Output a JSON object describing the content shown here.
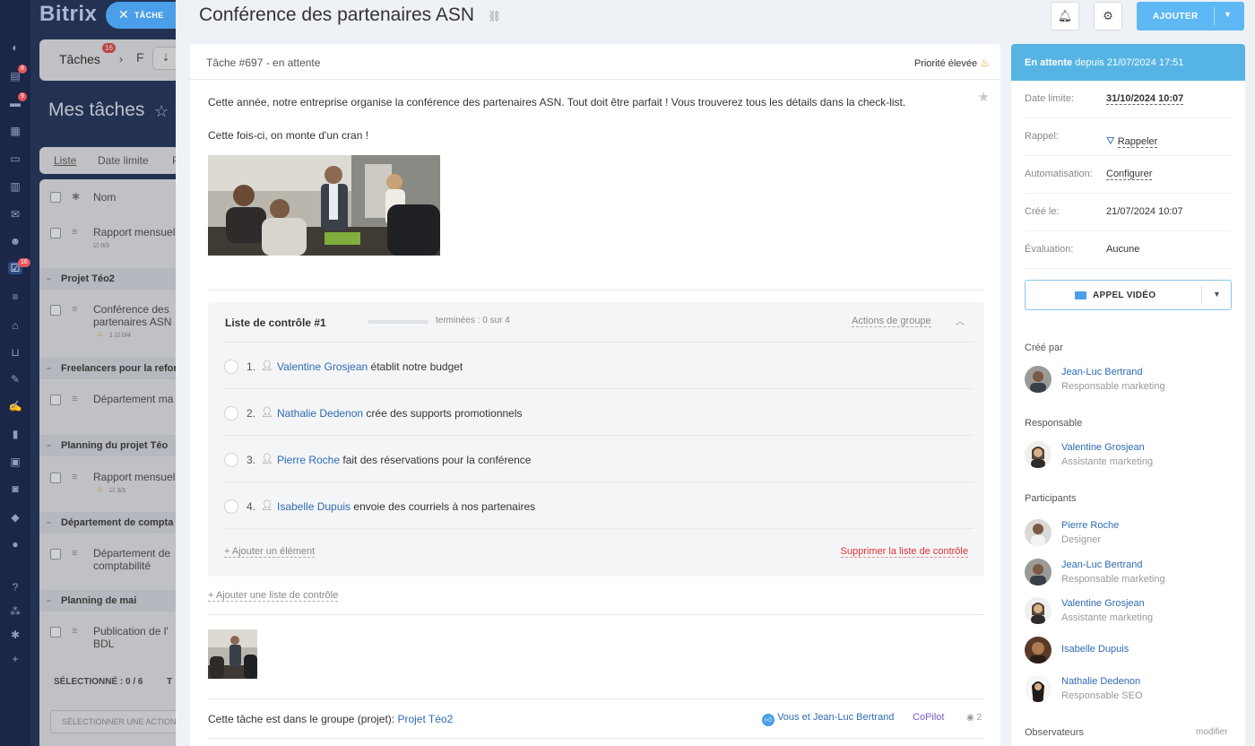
{
  "brand": "Bitrix",
  "close_pill": {
    "label": "TÂCHE"
  },
  "rail": {
    "badges": [
      "8",
      "9",
      "16"
    ]
  },
  "list_bg": {
    "tab_label": "Tâches",
    "tab_badge": "16",
    "tab_sep": "F",
    "heading": "Mes tâches",
    "view_tabs": [
      "Liste",
      "Date limite",
      "P"
    ],
    "column_name": "Nom",
    "rows": [
      {
        "type": "task",
        "text": "Rapport mensuel",
        "meta": "☑ 0/3"
      },
      {
        "type": "group",
        "text": "Projet Téo2"
      },
      {
        "type": "task",
        "text": "Conférence des",
        "text2": "partenaires ASN",
        "meta": "1    ☑ 0/4"
      },
      {
        "type": "group",
        "text": "Freelancers pour la refonte"
      },
      {
        "type": "task",
        "text": "Département ma"
      },
      {
        "type": "group",
        "text": "Planning du projet Téo"
      },
      {
        "type": "task",
        "text": "Rapport mensuel",
        "meta": "☑ 3/3"
      },
      {
        "type": "group",
        "text": "Département de compta"
      },
      {
        "type": "task",
        "text": "Département de",
        "text2": "comptabilité"
      },
      {
        "type": "group",
        "text": "Planning de mai"
      },
      {
        "type": "task",
        "text": "Publication de l'",
        "text2": "BDL"
      }
    ],
    "selected": "SÉLECTIONNÉ : 0 / 6",
    "selected_t": "T",
    "select_action": "SÉLECTIONNER UNE ACTION"
  },
  "header": {
    "title": "Conférence des partenaires ASN",
    "add_label": "AJOUTER"
  },
  "task": {
    "number_status": "Tâche #697 - en attente",
    "priority": "Priorité élevée",
    "description_1": "Cette année, notre entreprise organise la conférence des partenaires ASN. Tout doit être parfait ! Vous trouverez tous les détails dans la check-list.",
    "description_2": "Cette fois-ci, on monte d'un cran !",
    "add_checklist": "+ Ajouter une liste de contrôle",
    "group_prefix": "Cette tâche est dans le groupe (projet): ",
    "group_name": "Projet Téo2",
    "thanks": "Vous et Jean-Luc Bertrand",
    "copilot": "CoPilot",
    "views": "2"
  },
  "checklist": {
    "title": "Liste de contrôle #1",
    "progress_text": "terminées : 0 sur 4",
    "progress_fraction": 0,
    "group_actions": "Actions de groupe",
    "items": [
      {
        "num": "1.",
        "who": "Valentine Grosjean",
        "what": " établit notre budget"
      },
      {
        "num": "2.",
        "who": "Nathalie Dedenon",
        "what": " crée des supports promotionnels"
      },
      {
        "num": "3.",
        "who": "Pierre Roche",
        "what": " fait des réservations pour la conférence"
      },
      {
        "num": "4.",
        "who": "Isabelle Dupuis",
        "what": " envoie des courriels à nos partenaires"
      }
    ],
    "add_item": "+ Ajouter un élément",
    "delete": "Supprimer la liste de contrôle"
  },
  "sidebar": {
    "status_bold": "En attente",
    "status_rest": " depuis 21/07/2024 17:51",
    "fields": [
      {
        "key": "Date limite:",
        "value": "31/10/2024 10:07"
      },
      {
        "key": "Rappel:",
        "value": "Rappeler"
      },
      {
        "key": "Automatisation:",
        "value": "Configurer"
      },
      {
        "key": "Créé le:",
        "value": "21/07/2024 10:07"
      },
      {
        "key": "Évaluation:",
        "value": "Aucune"
      }
    ],
    "video_call": "APPEL VIDÉO",
    "created_by_label": "Créé par",
    "created_by": {
      "name": "Jean-Luc Bertrand",
      "role": "Responsable marketing"
    },
    "responsible_label": "Responsable",
    "responsible": {
      "name": "Valentine Grosjean",
      "role": "Assistante marketing"
    },
    "participants_label": "Participants",
    "participants": [
      {
        "name": "Pierre Roche",
        "role": "Designer"
      },
      {
        "name": "Jean-Luc Bertrand",
        "role": "Responsable marketing"
      },
      {
        "name": "Valentine Grosjean",
        "role": "Assistante marketing"
      },
      {
        "name": "Isabelle Dupuis",
        "role": ""
      },
      {
        "name": "Nathalie Dedenon",
        "role": "Responsable SEO"
      }
    ],
    "observers_label": "Observateurs",
    "observers_edit": "modifier"
  },
  "colors": {
    "accent": "#5db8f4",
    "status": "#56b4e4",
    "link": "#2f6bb5",
    "danger": "#dd3333",
    "fire": "#f0931c"
  }
}
